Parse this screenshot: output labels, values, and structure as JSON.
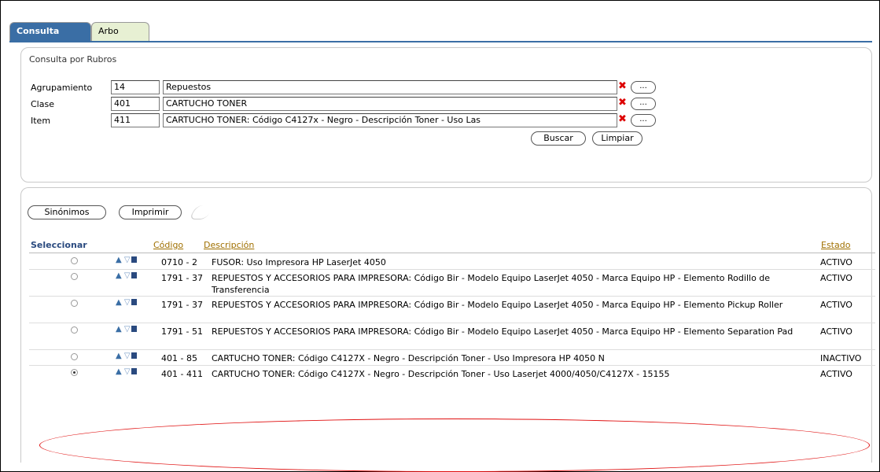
{
  "tabs": {
    "consulta": "Consulta",
    "arbol": "Arbo"
  },
  "filter": {
    "title": "Consulta por Rubros",
    "fields": [
      {
        "label": "Agrupamiento",
        "code": "14",
        "desc": "Repuestos"
      },
      {
        "label": "Clase",
        "code": "401",
        "desc": "CARTUCHO TONER"
      },
      {
        "label": "Item",
        "code": "411",
        "desc": "CARTUCHO TONER: Código C4127x - Negro - Descripción Toner - Uso Las"
      }
    ],
    "lov_label": "...",
    "required_mark": "✖",
    "buscar": "Buscar",
    "limpiar": "Limpiar"
  },
  "results": {
    "sinonimos": "Sinónimos",
    "imprimir": "Imprimir",
    "headers": {
      "seleccionar": "Seleccionar",
      "codigo": "Código",
      "descripcion": "Descripción",
      "estado": "Estado"
    },
    "rows": [
      {
        "code": "0710 - 2",
        "desc": "FUSOR: Uso Impresora HP LaserJet 4050",
        "estado": "ACTIVO",
        "selected": false
      },
      {
        "code": "1791 - 37",
        "desc": "REPUESTOS Y ACCESORIOS PARA IMPRESORA: Código Bir - Modelo Equipo LaserJet 4050 - Marca Equipo HP - Elemento Rodillo de Transferencia",
        "estado": "ACTIVO",
        "selected": false
      },
      {
        "code": "1791 - 37",
        "desc": "REPUESTOS Y ACCESORIOS PARA IMPRESORA: Código Bir - Modelo Equipo LaserJet 4050 - Marca Equipo HP - Elemento Pickup Roller",
        "estado": "ACTIVO",
        "selected": false
      },
      {
        "code": "1791 - 51",
        "desc": "REPUESTOS Y ACCESORIOS PARA IMPRESORA: Código Bir - Modelo Equipo LaserJet 4050 - Marca Equipo HP - Elemento Separation Pad",
        "estado": "ACTIVO",
        "selected": false
      },
      {
        "code": "401 - 85",
        "desc": "CARTUCHO TONER: Código C4127X - Negro - Descripción Toner - Uso Impresora HP 4050 N",
        "estado": "INACTIVO",
        "selected": false
      },
      {
        "code": "401 - 411",
        "desc": "CARTUCHO TONER: Código C4127X - Negro - Descripción Toner - Uso Laserjet 4000/4050/C4127X - 15155",
        "estado": "ACTIVO",
        "selected": true
      }
    ]
  }
}
